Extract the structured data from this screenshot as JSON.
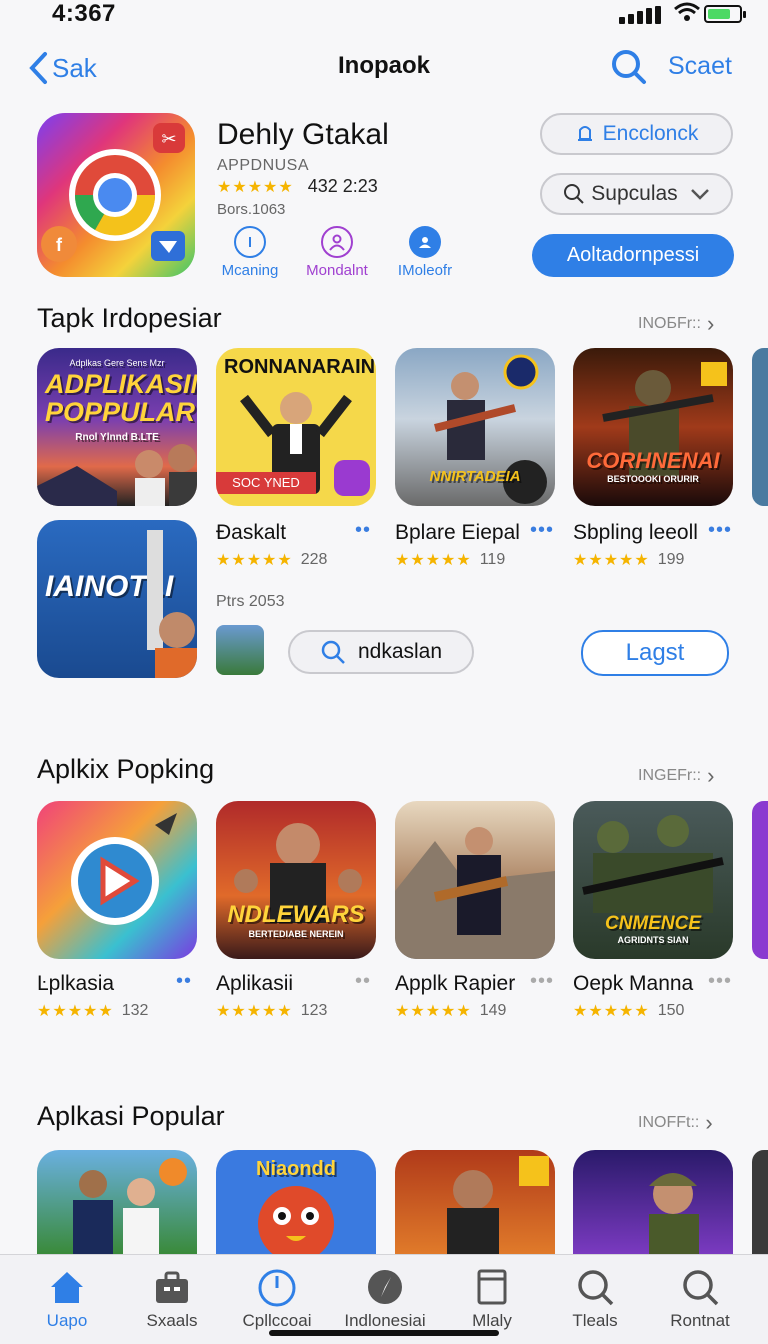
{
  "status": {
    "time": "4:367"
  },
  "nav": {
    "back_label": "Sak",
    "title": "Inopaok",
    "search_label": "Scaet"
  },
  "app": {
    "name": "Dehly Gtakal",
    "developer": "APPDNUSA",
    "rating_count": "432 2:23",
    "size": "Bors.1063",
    "meta": [
      {
        "label": "Mcaning",
        "icon": "info-icon",
        "color": "#2f7fe6"
      },
      {
        "label": "Mondalnt",
        "icon": "person-icon",
        "color": "#a040d0"
      },
      {
        "label": "IMoleofr",
        "icon": "user-circle-icon",
        "color": "#2f7fe6"
      }
    ],
    "buttons": {
      "first": "Encclonck",
      "dropdown": "Supculas",
      "primary": "Aoltadornpessi"
    }
  },
  "section1": {
    "title": "Tapk Irdopesiar",
    "more": "INOБFr::",
    "tiles": [
      {
        "art": "ADPLIKASIN POPPULAR",
        "art_sub": "Rnol Ylnnd B.LTE",
        "art_top": "Adplkas Gere Sens Mzr"
      },
      {
        "art": "RONNANARAIN",
        "art_sub": "SOC YNED"
      },
      {
        "art": "NNIRTADEIA"
      },
      {
        "art": "CORHNENAI",
        "art_sub": "BESTOOOKI ORURIR"
      }
    ],
    "items": [
      {
        "label": "Ðaskalt",
        "rating": "228"
      },
      {
        "label": "Bplare Eiepal",
        "rating": "119"
      },
      {
        "label": "Sbpling leeoll",
        "rating": "199"
      }
    ],
    "feature_tile": "IAINOTLI",
    "feature_meta": "Ptrs 2053",
    "search_chip": "ndkaslan",
    "last_button": "Lagst"
  },
  "section2": {
    "title": "Aplkix Popking",
    "more": "INGEFr::",
    "tiles": [
      {
        "art": ""
      },
      {
        "art": "NDLEWARS",
        "art_sub": "BERTEDIABE NEREIN"
      },
      {
        "art": ""
      },
      {
        "art": "CNMENCE",
        "art_sub": "AGRIDNTS SIAN"
      }
    ],
    "items": [
      {
        "label": "Ŀplkasia",
        "rating": "132"
      },
      {
        "label": "Aplikasii",
        "rating": "123"
      },
      {
        "label": "Applk Rapier",
        "rating": "149"
      },
      {
        "label": "Oepk Manna",
        "rating": "150"
      }
    ]
  },
  "section3": {
    "title": "Aplkasi Popular",
    "more": "INOFFt::",
    "tiles": [
      {
        "art": ""
      },
      {
        "art": "Niaondd"
      },
      {
        "art": ""
      },
      {
        "art": ""
      }
    ]
  },
  "tabs": [
    {
      "label": "Uapo",
      "icon": "house-icon",
      "active": true
    },
    {
      "label": "Sxaals",
      "icon": "briefcase-icon",
      "active": false
    },
    {
      "label": "Cpllccoai",
      "icon": "timer-icon",
      "active": false
    },
    {
      "label": "Indlonesiai",
      "icon": "compass-icon",
      "active": false
    },
    {
      "label": "Mlaly",
      "icon": "document-icon",
      "active": false
    },
    {
      "label": "Tleals",
      "icon": "search-icon",
      "active": false
    },
    {
      "label": "Rontnat",
      "icon": "search-icon",
      "active": false
    }
  ],
  "colors": {
    "accent": "#2f7fe6",
    "star": "#f5b400"
  }
}
